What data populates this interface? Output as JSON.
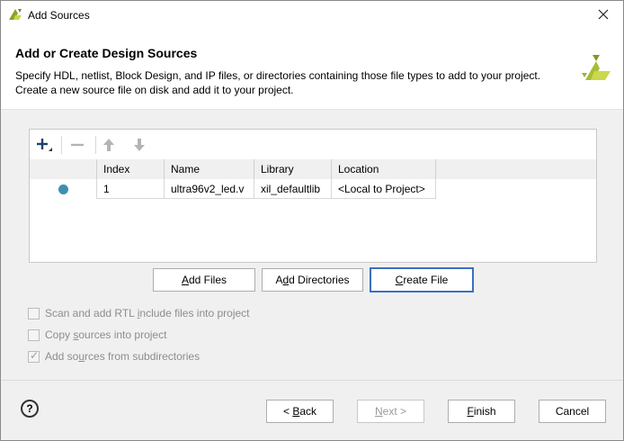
{
  "window": {
    "title": "Add Sources",
    "close_label": "×"
  },
  "header": {
    "title": "Add or Create Design Sources",
    "description_line1": "Specify HDL, netlist, Block Design, and IP files, or directories containing those file types to add to your project.",
    "description_line2": "Create a new source file on disk and add it to your project."
  },
  "toolbar": {
    "add_icon": "plus-icon",
    "remove_icon": "minus-icon",
    "up_icon": "arrow-up-icon",
    "down_icon": "arrow-down-icon"
  },
  "table": {
    "columns": [
      "",
      "Index",
      "Name",
      "Library",
      "Location"
    ],
    "rows": [
      {
        "status": "dot",
        "index": "1",
        "name": "ultra96v2_led.v",
        "library": "xil_defaultlib",
        "location": "<Local to Project>"
      }
    ]
  },
  "actions": {
    "add_files": {
      "pre": "",
      "ul": "A",
      "post": "dd Files"
    },
    "add_dirs": {
      "pre": "A",
      "ul": "d",
      "post": "d Directories"
    },
    "create_file": {
      "pre": "",
      "ul": "C",
      "post": "reate File"
    }
  },
  "options": {
    "scan_rtl": {
      "pre": "Scan and add RTL ",
      "ul": "i",
      "post": "nclude files into project",
      "checked": false
    },
    "copy_sources": {
      "pre": "Copy ",
      "ul": "s",
      "post": "ources into project",
      "checked": false
    },
    "subdirs": {
      "pre": "Add so",
      "ul": "u",
      "post": "rces from subdirectories",
      "checked": true
    }
  },
  "footer": {
    "help": "?",
    "back": {
      "pre": "< ",
      "ul": "B",
      "post": "ack"
    },
    "next": {
      "pre": "",
      "ul": "N",
      "post": "ext >"
    },
    "finish": {
      "pre": "",
      "ul": "F",
      "post": "inish"
    },
    "cancel": "Cancel"
  },
  "colors": {
    "accent": "#3a6fc4",
    "status_dot": "#3d8fb0",
    "logo": "#b5c934"
  }
}
